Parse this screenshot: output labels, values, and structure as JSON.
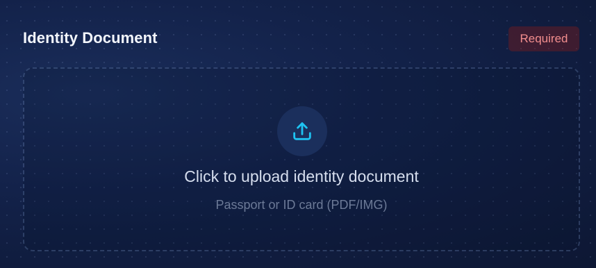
{
  "section": {
    "title": "Identity Document",
    "badge": "Required"
  },
  "upload": {
    "icon": "upload-icon",
    "title": "Click to upload identity document",
    "subtitle": "Passport or ID card (PDF/IMG)"
  },
  "colors": {
    "accent": "#1ec3f2",
    "badge_text": "#f38e8e",
    "background": "#0f1c40"
  }
}
